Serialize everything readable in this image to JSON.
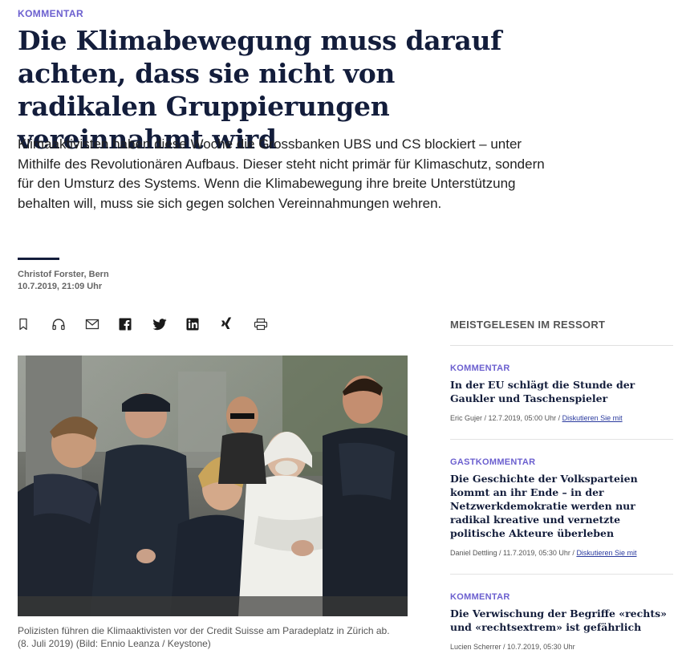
{
  "article": {
    "kicker": "KOMMENTAR",
    "headline": "Die Klimabewegung muss darauf achten, dass sie nicht von radikalen Gruppierungen vereinnahmt wird",
    "lead": "Klimaaktivisten haben diese Woche die Grossbanken UBS und CS blockiert – unter Mithilfe des Revolutionären Aufbaus. Dieser steht nicht primär für Klimaschutz, sondern für den Umsturz des Systems. Wenn die Klimabewegung ihre breite Unterstützung behalten will, muss sie sich gegen solchen Vereinnahmungen wehren.",
    "author": "Christof Forster, Bern",
    "date": "10.7.2019, 21:09 Uhr",
    "caption": "Polizisten führen die Klimaaktivisten vor der Credit Suisse am Paradeplatz in Zürich ab. (8. Juli 2019) (Bild: Ennio Leanza / Keystone)"
  },
  "share_icons": [
    "bookmark-icon",
    "headphones-icon",
    "mail-icon",
    "facebook-icon",
    "twitter-icon",
    "linkedin-icon",
    "xing-icon",
    "print-icon"
  ],
  "sidebar": {
    "title": "MEISTGELESEN IM RESSORT",
    "items": [
      {
        "kicker": "KOMMENTAR",
        "title": "In der EU schlägt die Stunde der Gaukler und Taschenspieler",
        "meta": "Eric Gujer / 12.7.2019, 05:00 Uhr / ",
        "link": "Diskutieren Sie mit"
      },
      {
        "kicker": "GASTKOMMENTAR",
        "title": "Die Geschichte der Volksparteien kommt an ihr Ende – in der Netzwerkdemokratie werden nur radikal kreative und vernetzte politische Akteure überleben",
        "meta": "Daniel Dettling / 11.7.2019, 05:30 Uhr / ",
        "link": "Diskutieren Sie mit"
      },
      {
        "kicker": "KOMMENTAR",
        "title": "Die Verwischung der Begriffe «rechts» und «rechtsextrem» ist gefährlich",
        "meta": "Lucien Scherrer / 10.7.2019, 05:30 Uhr",
        "link": ""
      }
    ]
  },
  "colors": {
    "accent": "#6b5fcf",
    "headline": "#131d3b",
    "link": "#2a3a9e"
  }
}
